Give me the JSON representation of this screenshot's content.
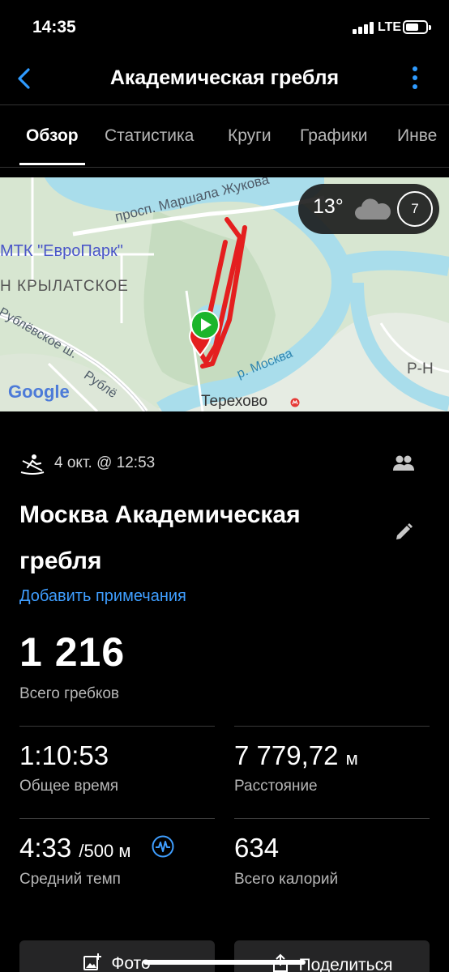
{
  "status_bar": {
    "time": "14:35",
    "network": "LTE",
    "battery_level": 0.5
  },
  "nav": {
    "title": "Академическая гребля",
    "back_icon": "chevron-left-icon",
    "more_icon": "more-vertical-icon",
    "accent": "#2f9bff"
  },
  "tabs": [
    {
      "label": "Обзор",
      "active": true
    },
    {
      "label": "Статистика",
      "active": false
    },
    {
      "label": "Круги",
      "active": false
    },
    {
      "label": "Графики",
      "active": false
    },
    {
      "label": "Инве",
      "active": false
    }
  ],
  "map": {
    "labels": {
      "street_top": "просп. Маршала Жукова",
      "mall": "МТК \"ЕвроПарк\"",
      "district": "Н КРЫЛАТСКОЕ",
      "highway_1": "Рублёвское ш.",
      "highway_2": "Рублё",
      "river": "р. Москва",
      "metro": "Терехово",
      "corner": "Р-Н",
      "provider": "Google"
    },
    "weather": {
      "temperature": "13°",
      "icon": "cloud-icon",
      "wind": "7"
    },
    "route_color": "#e41f1f",
    "start_color": "#1cb52c"
  },
  "activity": {
    "type_icon": "rowing-icon",
    "date": "4 окт. @ 12:53",
    "name": "Москва Академическая гребля",
    "add_notes": "Добавить примечания",
    "accent": "#3f9eff"
  },
  "summary": {
    "value": "1 216",
    "label": "Всего гребков"
  },
  "stats": [
    {
      "value": "1:10:53",
      "unit": "",
      "label": "Общее время"
    },
    {
      "value": "7 779,72",
      "unit": "м",
      "label": "Расстояние"
    },
    {
      "value": "4:33",
      "unit": "/500 м",
      "label": "Средний темп"
    },
    {
      "value": "634",
      "unit": "",
      "label": "Всего калорий"
    }
  ],
  "actions": {
    "photo": "Фото",
    "share": "Поделиться"
  }
}
